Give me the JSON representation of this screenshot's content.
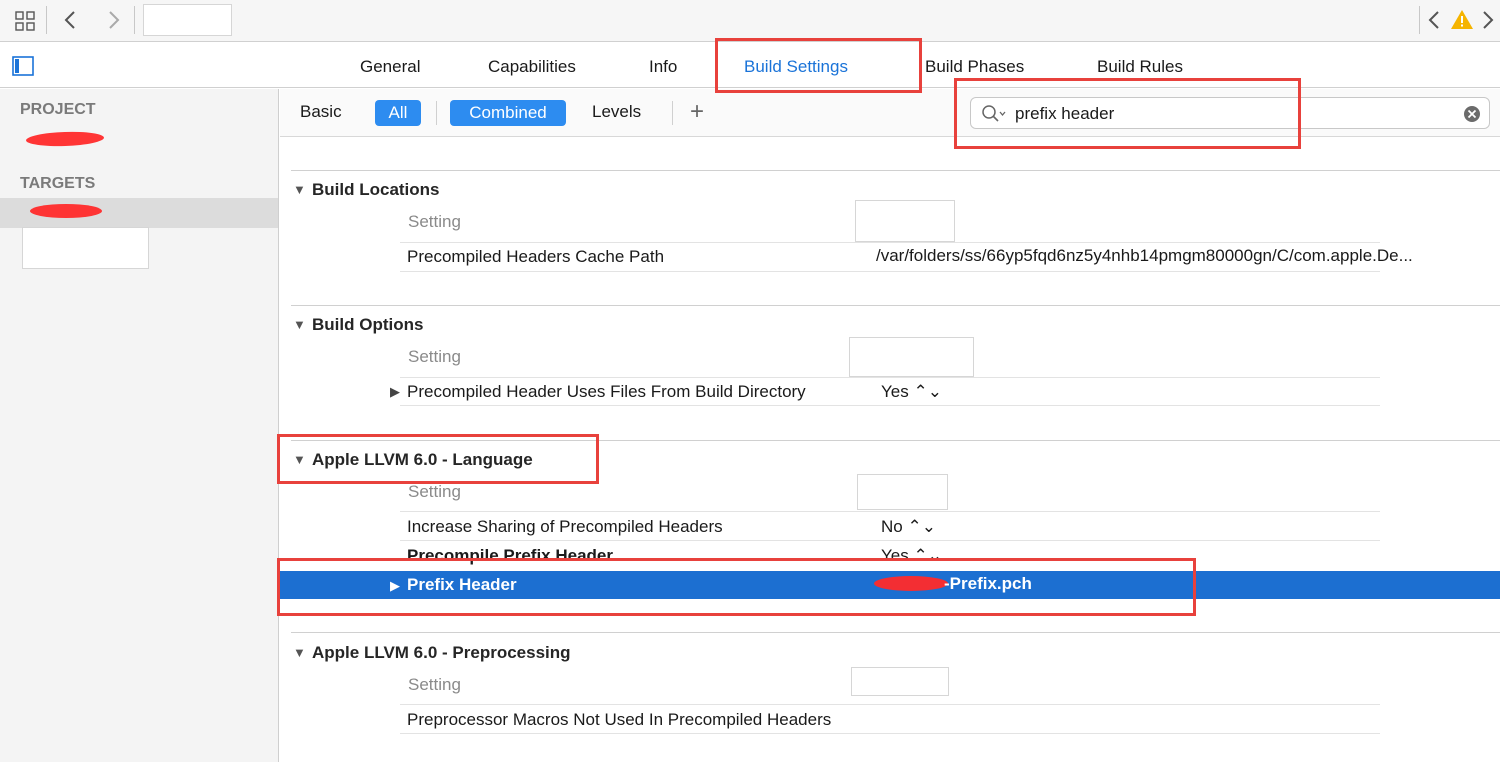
{
  "toolbar": {
    "grid_icon": "grid-icon",
    "back_icon": "chevron-left-icon",
    "forward_icon": "chevron-right-icon",
    "nav_back_icon": "chevron-left-icon",
    "warning_icon": "warning-icon",
    "nav_forward_icon": "chevron-right-icon",
    "back_glyph": "<",
    "forward_glyph": ">",
    "warning_glyph": "⚠"
  },
  "tabs": [
    {
      "label": "General"
    },
    {
      "label": "Capabilities"
    },
    {
      "label": "Info"
    },
    {
      "label": "Build Settings",
      "active": true
    },
    {
      "label": "Build Phases"
    },
    {
      "label": "Build Rules"
    }
  ],
  "sidebar": {
    "project_header": "PROJECT",
    "targets_header": "TARGETS"
  },
  "filters": {
    "basic": "Basic",
    "all": "All",
    "combined": "Combined",
    "levels": "Levels",
    "add": "+"
  },
  "search": {
    "value": "prefix header",
    "clear_icon": "clear-icon",
    "search_icon": "search-icon",
    "clear_glyph": "⊗"
  },
  "sections": [
    {
      "title": "Build Locations",
      "setting_label": "Setting",
      "rows": [
        {
          "name": "Precompiled Headers Cache Path",
          "value": "/var/folders/ss/66yp5fqd6nz5y4nhb14pmgm80000gn/C/com.apple.De..."
        }
      ]
    },
    {
      "title": "Build Options",
      "setting_label": "Setting",
      "rows": [
        {
          "name": "Precompiled Header Uses Files From Build Directory",
          "value": "Yes ⌃⌄"
        }
      ]
    },
    {
      "title": "Apple LLVM 6.0 - Language",
      "setting_label": "Setting",
      "rows": [
        {
          "name": "Increase Sharing of Precompiled Headers",
          "value": "No ⌃⌄"
        },
        {
          "name": "Precompile Prefix Header",
          "value": "Yes ⌃⌄"
        },
        {
          "name": "Prefix Header",
          "value": "-Prefix.pch",
          "selected": true
        }
      ]
    },
    {
      "title": "Apple LLVM 6.0 - Preprocessing",
      "setting_label": "Setting",
      "rows": [
        {
          "name": "Preprocessor Macros Not Used In Precompiled Headers",
          "value": ""
        }
      ]
    }
  ],
  "colors": {
    "accent": "#1a73d8",
    "selection": "#1c6fd1",
    "annotation": "#e8413c"
  }
}
